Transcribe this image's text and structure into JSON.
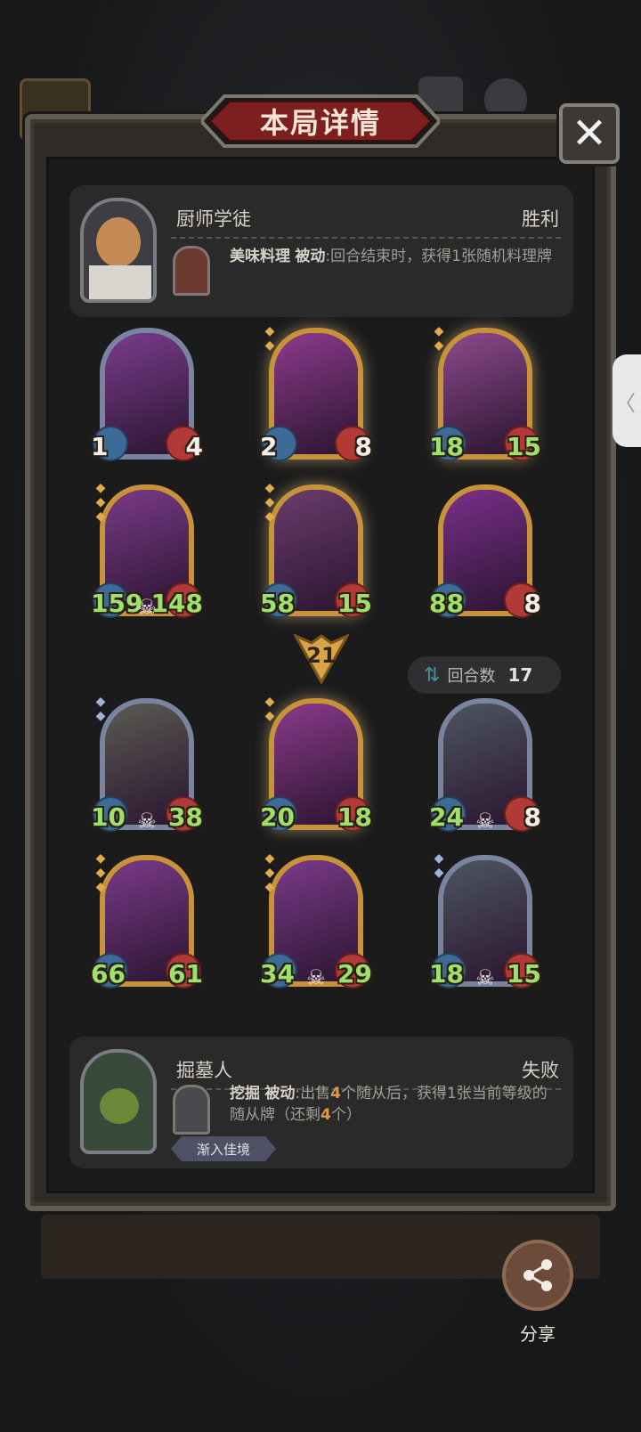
{
  "title": "本局详情",
  "close_label": "✕",
  "player": {
    "hero_name": "厨师学徒",
    "result": "胜利",
    "skill_name": "美味料理",
    "skill_type": "被动",
    "skill_desc": ":回合结束时，获得1张随机料理牌"
  },
  "opponent": {
    "hero_name": "掘墓人",
    "result": "失败",
    "skill_name": "挖掘",
    "skill_type": "被动",
    "skill_desc_1": ":出售",
    "skill_num_1": "4",
    "skill_desc_2": "个随从后，获得1张当前等级的随从牌（还剩",
    "skill_num_2": "4",
    "skill_desc_3": "个）",
    "badge": "渐入佳境"
  },
  "damage_taken": "21",
  "rounds": {
    "label": "回合数",
    "value": "17"
  },
  "player_cards": [
    {
      "atk": "1",
      "hp": "4",
      "frame": "silver",
      "tier": "",
      "art": "#7a3c8c"
    },
    {
      "atk": "2",
      "hp": "8",
      "frame": "gold",
      "tier": "◆◆",
      "art": "#8c3a8c"
    },
    {
      "atk": "18",
      "hp": "15",
      "frame": "gold",
      "tier": "◆◆",
      "art": "#8c4a8c"
    },
    {
      "atk": "159",
      "hp": "148",
      "frame": "goldplain",
      "tier": "◆◆◆",
      "art": "#7a3a88",
      "skull": "☠"
    },
    {
      "atk": "58",
      "hp": "15",
      "frame": "gold",
      "tier": "◆◆◆",
      "art": "#6a3c6c"
    },
    {
      "atk": "88",
      "hp": "8",
      "frame": "goldplain",
      "tier": "",
      "art": "#7a2f8a"
    }
  ],
  "opponent_cards": [
    {
      "atk": "10",
      "hp": "38",
      "frame": "silver",
      "tier": "◆◆",
      "art": "#5a5a52",
      "skull": "☠"
    },
    {
      "atk": "20",
      "hp": "18",
      "frame": "gold",
      "tier": "◆◆",
      "art": "#8a3a8a"
    },
    {
      "atk": "24",
      "hp": "8",
      "frame": "silver",
      "tier": "",
      "art": "#4d5660",
      "skull": "☠"
    },
    {
      "atk": "66",
      "hp": "61",
      "frame": "goldplain",
      "tier": "◆◆◆",
      "art": "#7a3a88"
    },
    {
      "atk": "34",
      "hp": "29",
      "frame": "goldplain",
      "tier": "◆◆◆",
      "art": "#7a3a88",
      "skull": "☠"
    },
    {
      "atk": "18",
      "hp": "15",
      "frame": "silver",
      "tier": "◆◆",
      "art": "#4d5660",
      "skull": "☠"
    }
  ],
  "share_label": "分享",
  "side_tab_label": "〈",
  "colors": {
    "accent_gold": "#c8923a",
    "stat_green": "#9fe06a",
    "banner_red": "#7d1f1f"
  }
}
